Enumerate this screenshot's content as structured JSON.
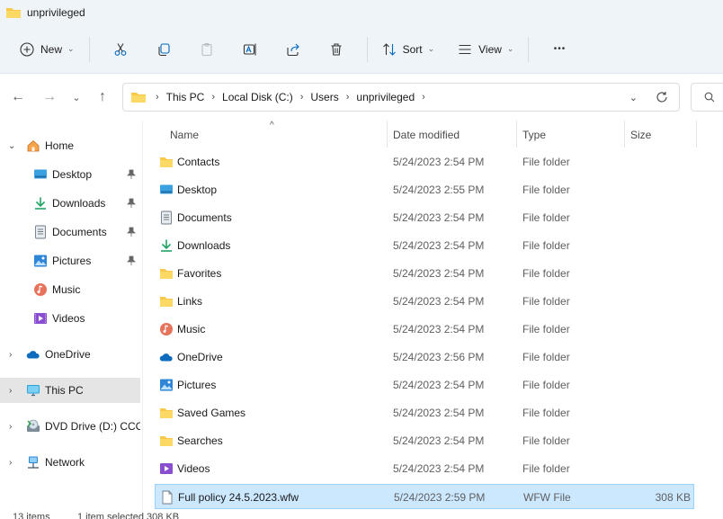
{
  "window": {
    "title": "unprivileged"
  },
  "toolbar": {
    "new_label": "New",
    "sort_label": "Sort",
    "view_label": "View",
    "more_label": "•••"
  },
  "address": {
    "crumbs": [
      "This PC",
      "Local Disk (C:)",
      "Users",
      "unprivileged"
    ]
  },
  "sidebar": {
    "home": "Home",
    "desktop": "Desktop",
    "downloads": "Downloads",
    "documents": "Documents",
    "pictures": "Pictures",
    "music": "Music",
    "videos": "Videos",
    "onedrive": "OneDrive",
    "thispc": "This PC",
    "dvd": "DVD Drive (D:) CCC",
    "network": "Network"
  },
  "columns": {
    "name": "Name",
    "date": "Date modified",
    "type": "Type",
    "size": "Size"
  },
  "files": [
    {
      "name": "Contacts",
      "date": "5/24/2023 2:54 PM",
      "type": "File folder",
      "size": "",
      "icon": "folder-icon"
    },
    {
      "name": "Desktop",
      "date": "5/24/2023 2:55 PM",
      "type": "File folder",
      "size": "",
      "icon": "desktop-icon"
    },
    {
      "name": "Documents",
      "date": "5/24/2023 2:54 PM",
      "type": "File folder",
      "size": "",
      "icon": "documents-icon"
    },
    {
      "name": "Downloads",
      "date": "5/24/2023 2:54 PM",
      "type": "File folder",
      "size": "",
      "icon": "download-icon"
    },
    {
      "name": "Favorites",
      "date": "5/24/2023 2:54 PM",
      "type": "File folder",
      "size": "",
      "icon": "folder-icon"
    },
    {
      "name": "Links",
      "date": "5/24/2023 2:54 PM",
      "type": "File folder",
      "size": "",
      "icon": "folder-icon"
    },
    {
      "name": "Music",
      "date": "5/24/2023 2:54 PM",
      "type": "File folder",
      "size": "",
      "icon": "music-icon"
    },
    {
      "name": "OneDrive",
      "date": "5/24/2023 2:56 PM",
      "type": "File folder",
      "size": "",
      "icon": "cloud-icon"
    },
    {
      "name": "Pictures",
      "date": "5/24/2023 2:54 PM",
      "type": "File folder",
      "size": "",
      "icon": "pictures-icon"
    },
    {
      "name": "Saved Games",
      "date": "5/24/2023 2:54 PM",
      "type": "File folder",
      "size": "",
      "icon": "folder-icon"
    },
    {
      "name": "Searches",
      "date": "5/24/2023 2:54 PM",
      "type": "File folder",
      "size": "",
      "icon": "folder-icon"
    },
    {
      "name": "Videos",
      "date": "5/24/2023 2:54 PM",
      "type": "File folder",
      "size": "",
      "icon": "videos-icon"
    },
    {
      "name": "Full policy 24.5.2023.wfw",
      "date": "5/24/2023 2:59 PM",
      "type": "WFW File",
      "size": "308 KB",
      "icon": "file-icon"
    }
  ],
  "status": {
    "items": "13 items",
    "selected": "1 item selected  308 KB"
  },
  "colors": {
    "folder": "#f8c84b",
    "selection": "#cce8ff",
    "accent": "#0067c0"
  }
}
